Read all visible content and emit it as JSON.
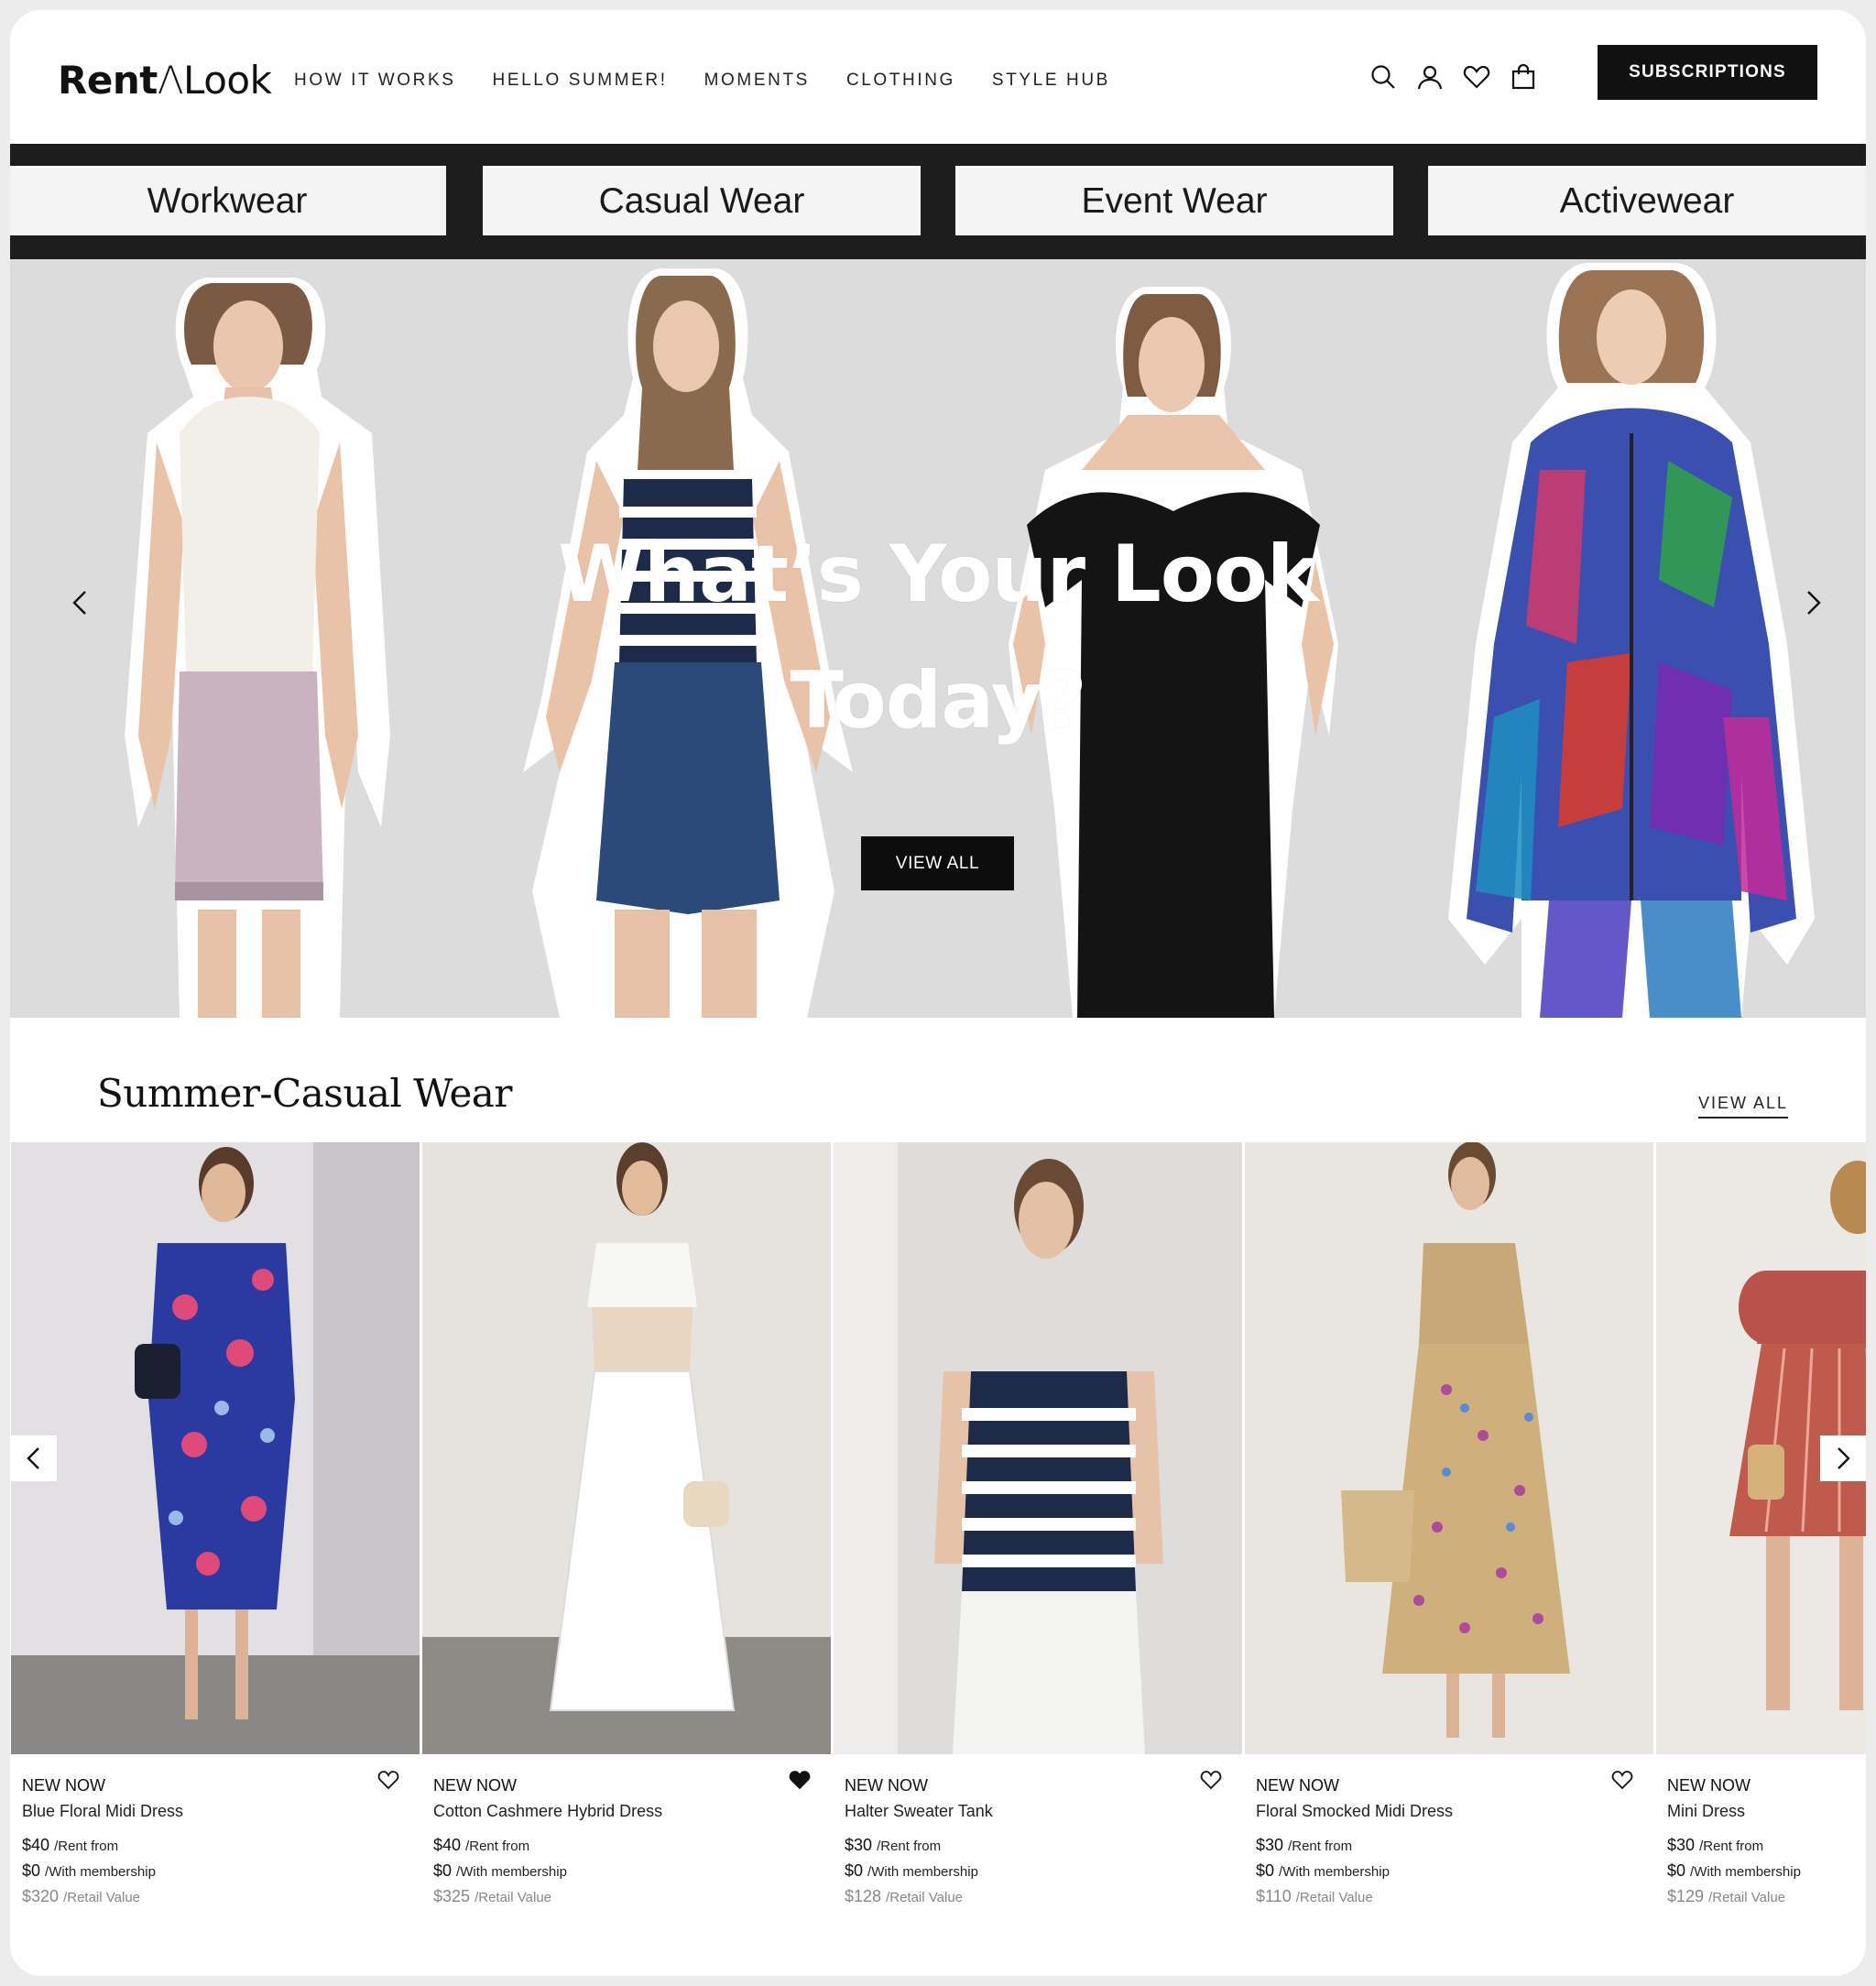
{
  "header": {
    "logo_left": "Rent",
    "logo_mark": "Λ",
    "logo_right": "Look",
    "nav": [
      "HOW IT WORKS",
      "HELLO SUMMER!",
      "MOMENTS",
      "CLOTHING",
      "STYLE HUB"
    ],
    "icons": [
      "search-icon",
      "account-icon",
      "heart-icon",
      "bag-icon"
    ],
    "subscribe_label": "SUBSCRIPTIONS"
  },
  "categories": [
    "Workwear",
    "Casual Wear",
    "Event Wear",
    "Activewear"
  ],
  "hero": {
    "title_line1": "What’s Your Look",
    "title_line2": "Today?",
    "button_label": "VIEW ALL"
  },
  "section": {
    "title": "Summer-Casual Wear",
    "view_all": "VIEW ALL"
  },
  "products": [
    {
      "tag": "NEW NOW",
      "name": "Blue Floral Midi Dress",
      "rent": "$40",
      "rent_label": "/Rent from",
      "member": "$0",
      "member_label": "/With membership",
      "retail": "$320",
      "retail_label": "/Retail Value",
      "favorited": false
    },
    {
      "tag": "NEW NOW",
      "name": "Cotton Cashmere Hybrid Dress",
      "rent": "$40",
      "rent_label": "/Rent from",
      "member": "$0",
      "member_label": "/With membership",
      "retail": "$325",
      "retail_label": "/Retail Value",
      "favorited": true
    },
    {
      "tag": "NEW NOW",
      "name": "Halter Sweater Tank",
      "rent": "$30",
      "rent_label": "/Rent from",
      "member": "$0",
      "member_label": "/With membership",
      "retail": "$128",
      "retail_label": "/Retail Value",
      "favorited": false
    },
    {
      "tag": "NEW NOW",
      "name": "Floral Smocked Midi Dress",
      "rent": "$30",
      "rent_label": "/Rent from",
      "member": "$0",
      "member_label": "/With membership",
      "retail": "$110",
      "retail_label": "/Retail Value",
      "favorited": false
    },
    {
      "tag": "NEW NOW",
      "name": "Mini Dress",
      "rent": "$30",
      "rent_label": "/Rent from",
      "member": "$0",
      "member_label": "/With membership",
      "retail": "$129",
      "retail_label": "/Retail Value",
      "favorited": false
    }
  ]
}
